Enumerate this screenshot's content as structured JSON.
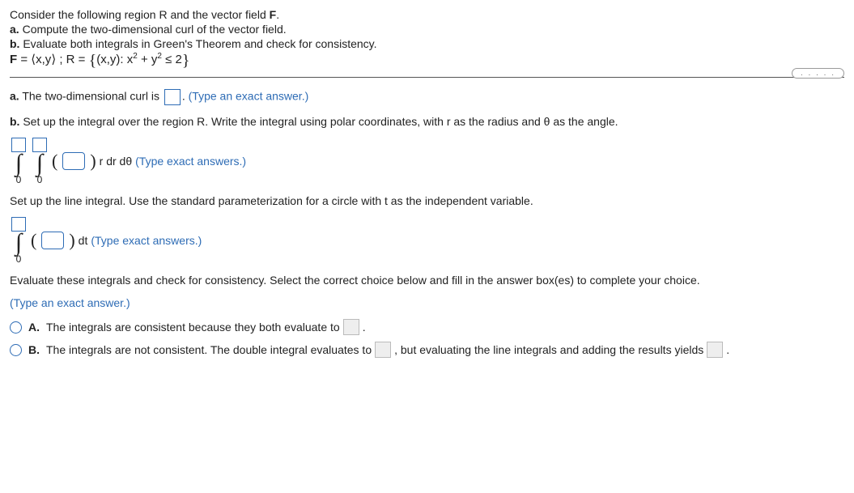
{
  "header": {
    "line1": "Consider the following region R and the vector field ",
    "vf": "F",
    "line1_end": ".",
    "a": "a.",
    "a_text": " Compute the two-dimensional curl of the vector field.",
    "b": "b.",
    "b_text": " Evaluate both integrals in Green's Theorem and check for consistency."
  },
  "formula": {
    "F_label": "F",
    "eq1": " = ",
    "open_angle": "⟨",
    "xy": "x,y",
    "close_angle": "⟩",
    "sep": " ; R = ",
    "open_curly": "{",
    "cond_pre": "(x,y): x",
    "sq": "2",
    "plus": " + y",
    "sq2": "2",
    "le": " ≤ 2",
    "close_curly": "}"
  },
  "ellipsis": ". . . . .",
  "partA": {
    "label": "a.",
    "text1": " The two-dimensional curl is ",
    "text2": ". ",
    "hint": "(Type an exact answer.)"
  },
  "partB": {
    "label": "b.",
    "text": " Set up the integral over the region R. Write the integral using polar coordinates, with r as the radius and θ as the angle."
  },
  "doubleInt": {
    "lower1": "0",
    "lower2": "0",
    "after_paren": "r dr dθ ",
    "hint": "(Type exact answers.)"
  },
  "lineIntSetup": "Set up the line integral. Use the standard parameterization for a circle with t as the independent variable.",
  "singleInt": {
    "lower": "0",
    "after_paren": " dt ",
    "hint": "(Type exact answers.)"
  },
  "evaluate": "Evaluate these integrals and check for consistency. Select the correct choice below and fill in the answer box(es) to complete your choice.",
  "evaluate_hint": "(Type an exact answer.)",
  "choiceA": {
    "letter": "A.",
    "text1": "The integrals are consistent because they both evaluate to ",
    "text2": "."
  },
  "choiceB": {
    "letter": "B.",
    "text1": "The integrals are not consistent. The double integral evaluates to ",
    "text2": ", but evaluating the line integrals and adding the results yields ",
    "text3": "."
  }
}
